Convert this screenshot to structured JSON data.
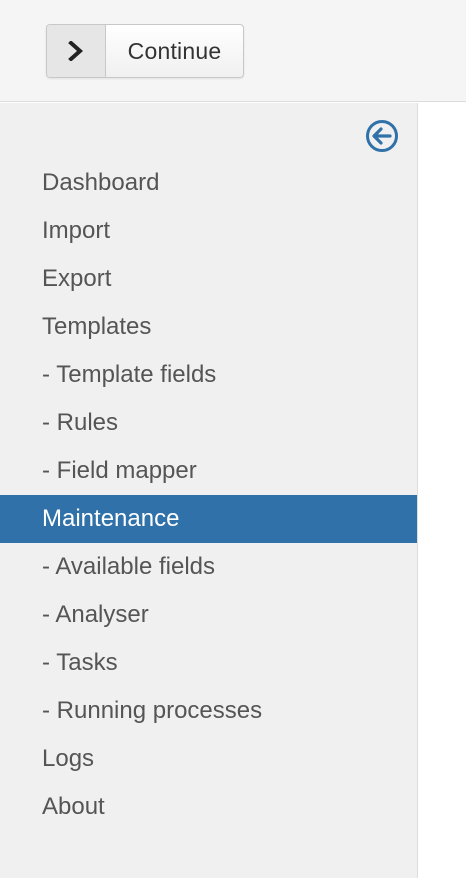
{
  "toolbar": {
    "continue_label": "Continue",
    "continue_icon": "chevron-right-icon"
  },
  "sidebar": {
    "toggle_icon": "arrow-circle-left-icon",
    "accent_color": "#2f71a8",
    "items": [
      {
        "label": "Dashboard",
        "active": false
      },
      {
        "label": "Import",
        "active": false
      },
      {
        "label": "Export",
        "active": false
      },
      {
        "label": "Templates",
        "active": false
      },
      {
        "label": "- Template fields",
        "active": false
      },
      {
        "label": "- Rules",
        "active": false
      },
      {
        "label": "- Field mapper",
        "active": false
      },
      {
        "label": "Maintenance",
        "active": true
      },
      {
        "label": "- Available fields",
        "active": false
      },
      {
        "label": "- Analyser",
        "active": false
      },
      {
        "label": "- Tasks",
        "active": false
      },
      {
        "label": "- Running processes",
        "active": false
      },
      {
        "label": "Logs",
        "active": false
      },
      {
        "label": "About",
        "active": false
      }
    ]
  }
}
